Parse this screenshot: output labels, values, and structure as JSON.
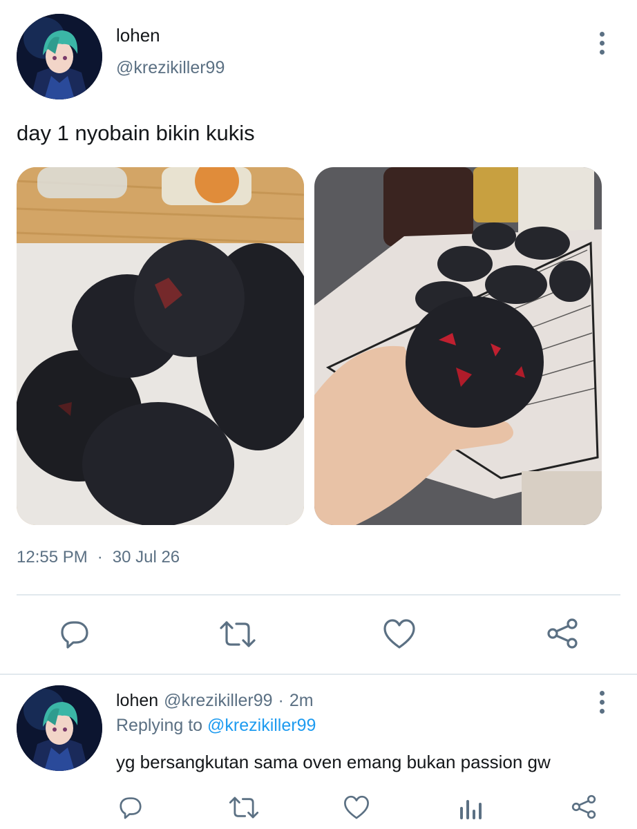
{
  "tweet": {
    "author": {
      "display_name": "lohen",
      "handle": "@krezikiller99",
      "avatar_icon": "anime-avatar-icon"
    },
    "more_icon": "more-vertical-icon",
    "text": "day 1 nyobain bikin kukis",
    "photos": [
      {
        "icon": "burnt-cookies-pile-photo"
      },
      {
        "icon": "burnt-cookie-in-hand-photo"
      }
    ],
    "time": "12:55 PM",
    "separator": "·",
    "date": "30 Jul 26",
    "actions": [
      {
        "name": "reply",
        "icon": "reply-icon"
      },
      {
        "name": "retweet",
        "icon": "retweet-icon"
      },
      {
        "name": "like",
        "icon": "heart-icon"
      },
      {
        "name": "share",
        "icon": "share-icon"
      }
    ]
  },
  "reply": {
    "author": {
      "display_name": "lohen",
      "handle": "@krezikiller99",
      "separator": "·",
      "time_ago": "2m",
      "avatar_icon": "anime-avatar-icon"
    },
    "replying_prefix": "Replying to",
    "replying_handle": "@krezikiller99",
    "text": "yg bersangkutan sama oven emang bukan passion gw",
    "actions": [
      {
        "name": "reply",
        "icon": "reply-icon"
      },
      {
        "name": "retweet",
        "icon": "retweet-icon"
      },
      {
        "name": "like",
        "icon": "heart-icon"
      },
      {
        "name": "analytics",
        "icon": "analytics-icon"
      },
      {
        "name": "share",
        "icon": "share-icon"
      }
    ]
  },
  "colors": {
    "text_primary": "#14171a",
    "text_secondary": "#5b7083",
    "link": "#1d9bf0",
    "divider": "#e1e8ed",
    "icon": "#5b7083"
  }
}
